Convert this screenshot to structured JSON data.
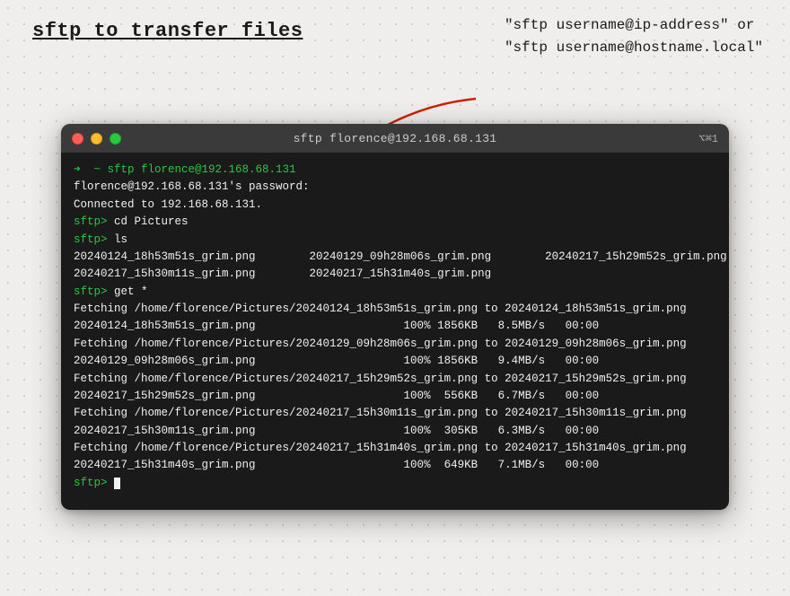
{
  "page": {
    "title": "sftp to transfer files",
    "annotation_line1": "\"sftp username@ip-address\" or",
    "annotation_line2": "\"sftp username@hostname.local\""
  },
  "terminal": {
    "titlebar_title": "sftp florence@192.168.68.131",
    "titlebar_shortcut": "⌥⌘1",
    "lines": [
      {
        "type": "prompt",
        "text": "➜  ~ sftp florence@192.168.68.131",
        "color": "green"
      },
      {
        "type": "normal",
        "text": "florence@192.168.68.131's password:"
      },
      {
        "type": "normal",
        "text": "Connected to 192.168.68.131."
      },
      {
        "type": "sftp",
        "text": "sftp> cd Pictures"
      },
      {
        "type": "sftp",
        "text": "sftp> ls"
      },
      {
        "type": "normal",
        "text": "20240124_18h53m51s_grim.png        20240129_09h28m06s_grim.png        20240217_15h29m52s_grim.png"
      },
      {
        "type": "normal",
        "text": "20240217_15h30m11s_grim.png        20240217_15h31m40s_grim.png"
      },
      {
        "type": "sftp",
        "text": "sftp> get *"
      },
      {
        "type": "normal",
        "text": "Fetching /home/florence/Pictures/20240124_18h53m51s_grim.png to 20240124_18h53m51s_grim.png"
      },
      {
        "type": "progress",
        "text": "20240124_18h53m51s_grim.png                      100% 1856KB   8.5MB/s   00:00"
      },
      {
        "type": "normal",
        "text": "Fetching /home/florence/Pictures/20240129_09h28m06s_grim.png to 20240129_09h28m06s_grim.png"
      },
      {
        "type": "progress",
        "text": "20240129_09h28m06s_grim.png                      100% 1856KB   9.4MB/s   00:00"
      },
      {
        "type": "normal",
        "text": "Fetching /home/florence/Pictures/20240217_15h29m52s_grim.png to 20240217_15h29m52s_grim.png"
      },
      {
        "type": "progress",
        "text": "20240217_15h29m52s_grim.png                      100%  556KB   6.7MB/s   00:00"
      },
      {
        "type": "normal",
        "text": "Fetching /home/florence/Pictures/20240217_15h30m11s_grim.png to 20240217_15h30m11s_grim.png"
      },
      {
        "type": "progress",
        "text": "20240217_15h30m11s_grim.png                      100%  305KB   6.3MB/s   00:00"
      },
      {
        "type": "normal",
        "text": "Fetching /home/florence/Pictures/20240217_15h31m40s_grim.png to 20240217_15h31m40s_grim.png"
      },
      {
        "type": "progress",
        "text": "20240217_15h31m40s_grim.png                      100%  649KB   7.1MB/s   00:00"
      },
      {
        "type": "sftp_cursor",
        "text": "sftp> "
      }
    ]
  }
}
